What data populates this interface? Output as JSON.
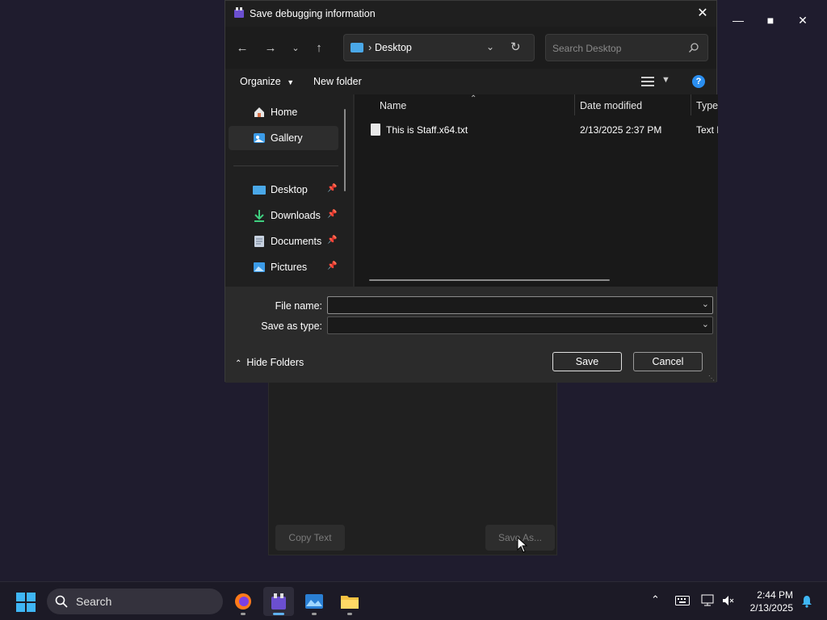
{
  "background_app": {
    "copy_text_label": "Copy Text",
    "save_as_label": "Save As..."
  },
  "dialog": {
    "title": "Save debugging information",
    "address": {
      "location": "Desktop"
    },
    "search": {
      "placeholder": "Search Desktop"
    },
    "commands": {
      "organize": "Organize",
      "new_folder": "New folder"
    },
    "sidebar": {
      "items": [
        {
          "label": "Home",
          "icon": "home-icon",
          "selected": false,
          "pinned": false
        },
        {
          "label": "Gallery",
          "icon": "gallery-icon",
          "selected": true,
          "pinned": false
        },
        {
          "label": "Desktop",
          "icon": "desktop-icon",
          "selected": false,
          "pinned": true
        },
        {
          "label": "Downloads",
          "icon": "download-icon",
          "selected": false,
          "pinned": true
        },
        {
          "label": "Documents",
          "icon": "documents-icon",
          "selected": false,
          "pinned": true
        },
        {
          "label": "Pictures",
          "icon": "pictures-icon",
          "selected": false,
          "pinned": true
        }
      ]
    },
    "columns": {
      "name": "Name",
      "date_modified": "Date modified",
      "type": "Type"
    },
    "files": [
      {
        "name": "This is Staff.x64.txt",
        "date_modified": "2/13/2025 2:37 PM",
        "type": "Text Document"
      }
    ],
    "file_name": {
      "label": "File name:",
      "value": ""
    },
    "save_as_type": {
      "label": "Save as type:",
      "value": ""
    },
    "hide_folders": "Hide Folders",
    "save_label": "Save",
    "cancel_label": "Cancel"
  },
  "taskbar": {
    "search_label": "Search",
    "time": "2:44 PM",
    "date": "2/13/2025"
  },
  "colors": {
    "desktop_bg": "#1f1c2e",
    "dialog_bg": "#202020",
    "accent": "#2a8ef0"
  }
}
